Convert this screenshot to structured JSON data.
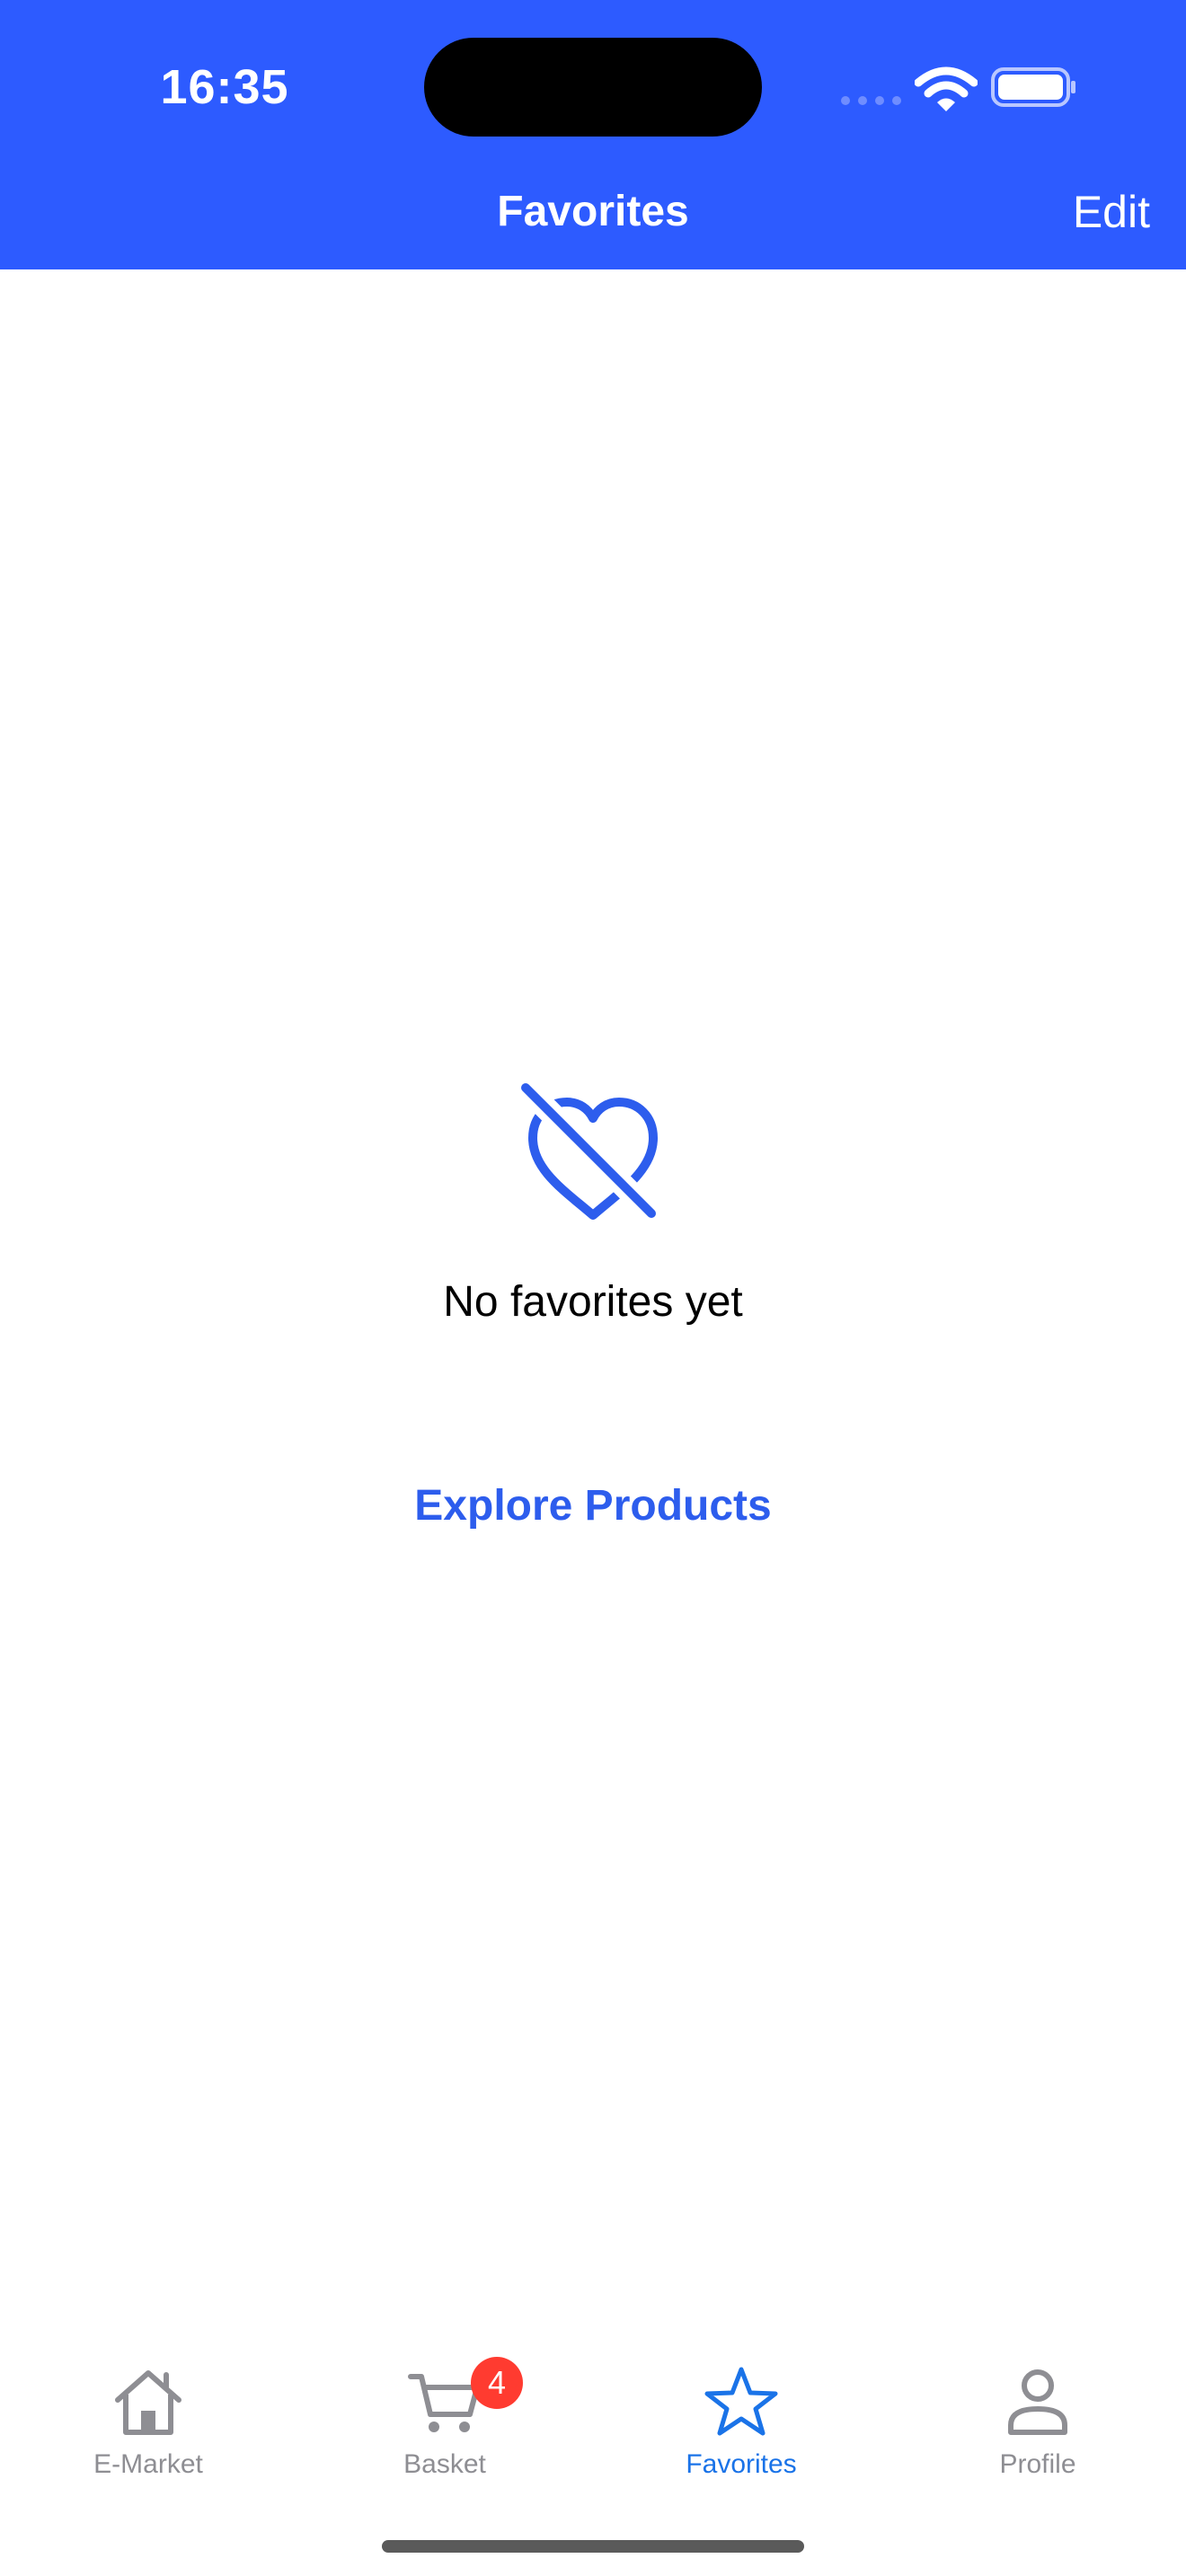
{
  "status_bar": {
    "time": "16:35",
    "icons": [
      "cellular-signal-icon",
      "wifi-icon",
      "battery-icon"
    ]
  },
  "nav_bar": {
    "title": "Favorites",
    "edit_label": "Edit"
  },
  "empty_state": {
    "icon": "heart-slash-icon",
    "message": "No favorites yet",
    "action_label": "Explore Products"
  },
  "tab_bar": {
    "tabs": [
      {
        "label": "E-Market",
        "icon": "house-icon",
        "active": false
      },
      {
        "label": "Basket",
        "icon": "cart-icon",
        "active": false,
        "badge": "4"
      },
      {
        "label": "Favorites",
        "icon": "star-icon",
        "active": true
      },
      {
        "label": "Profile",
        "icon": "person-icon",
        "active": false
      }
    ]
  },
  "colors": {
    "brand_blue": "#2d5bff",
    "accent_blue": "#2d5ded",
    "tab_active": "#1a73e8",
    "tab_inactive": "#8e8e93",
    "badge_red": "#ff3b30"
  }
}
